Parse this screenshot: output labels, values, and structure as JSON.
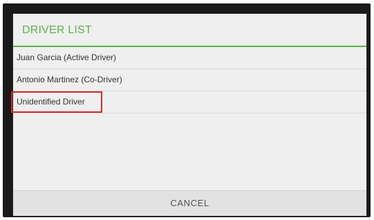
{
  "dialog": {
    "title": "DRIVER LIST",
    "accent_color": "#5cb34b",
    "highlight_color": "#d12b2b",
    "items": [
      {
        "label": "Juan Garcia (Active Driver)"
      },
      {
        "label": "Antonio Martinez (Co-Driver)"
      },
      {
        "label": "Unidentified Driver"
      }
    ],
    "cancel_label": "CANCEL"
  }
}
